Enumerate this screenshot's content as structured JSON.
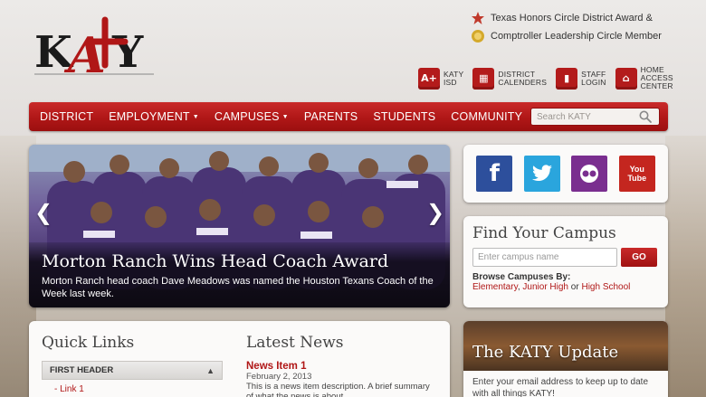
{
  "award": {
    "line1": "Texas Honors Circle District Award &",
    "line2": "Comptroller Leadership Circle Member"
  },
  "quick_icons": [
    {
      "icon": "a-plus-icon",
      "glyph": "A+",
      "label1": "KATY",
      "label2": "ISD"
    },
    {
      "icon": "calendar-icon",
      "glyph": "▦",
      "label1": "DISTRICT",
      "label2": "CALENDERS"
    },
    {
      "icon": "staff-login-icon",
      "glyph": "▮",
      "label1": "STAFF",
      "label2": "LOGIN"
    },
    {
      "icon": "home-access-icon",
      "glyph": "⌂",
      "label1": "HOME",
      "label2": "ACCESS",
      "label3": "CENTER"
    }
  ],
  "nav": {
    "items": [
      "DISTRICT",
      "EMPLOYMENT",
      "CAMPUSES",
      "PARENTS",
      "STUDENTS",
      "COMMUNITY"
    ],
    "search_placeholder": "Search KATY"
  },
  "slider": {
    "headline": "Morton Ranch Wins Head Coach Award",
    "description": "Morton Ranch head coach Dave Meadows was named the Houston Texans Coach of the Week last week.",
    "prev_glyph": "❮",
    "next_glyph": "❯"
  },
  "social": {
    "facebook": "f",
    "youtube_line1": "You",
    "youtube_line2": "Tube"
  },
  "find_campus": {
    "title": "Find Your Campus",
    "placeholder": "Enter campus name",
    "go_label": "GO",
    "browse_title": "Browse Campuses By:",
    "link_elementary": "Elementary",
    "link_junior": "Junior High",
    "or": "or",
    "link_high": "High School"
  },
  "quick_links": {
    "title": "Quick Links",
    "header": "FIRST HEADER",
    "link1": "Link 1"
  },
  "latest_news": {
    "title": "Latest News",
    "item_title": "News Item 1",
    "date": "February 2, 2013",
    "description": "This is a news item description. A brief summary of what the news is about."
  },
  "katy_update": {
    "title": "The KATY Update",
    "text": "Enter your email address to keep up to date with all things KATY!"
  },
  "colors": {
    "brand_red": "#b01717",
    "facebook": "#2d4f9c",
    "twitter": "#2aa5dd",
    "flickr": "#7a2e8f",
    "youtube": "#c4261f"
  }
}
